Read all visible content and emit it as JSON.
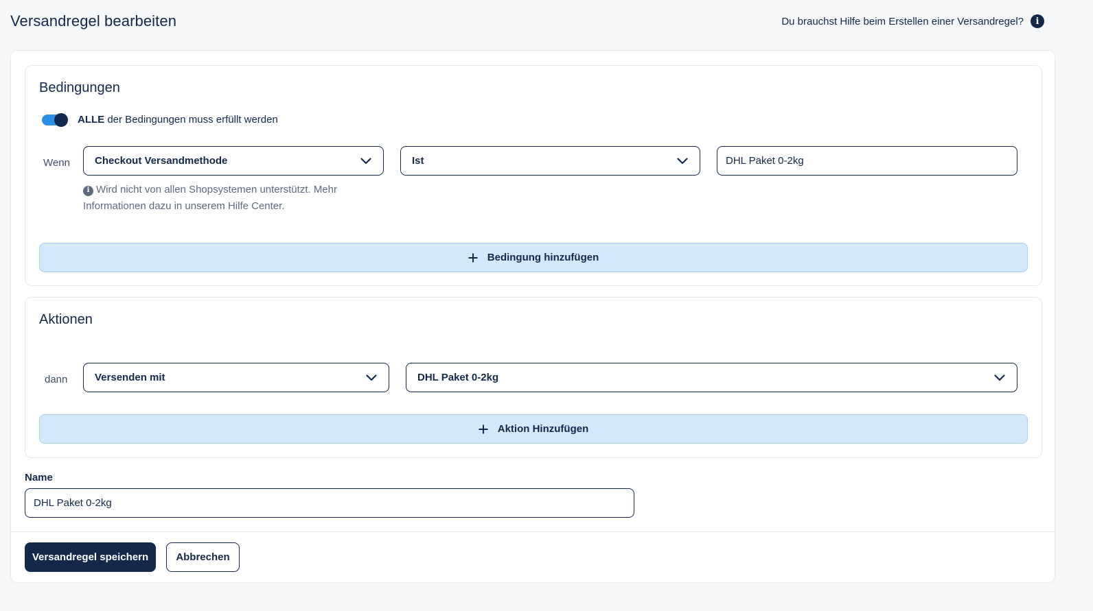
{
  "header": {
    "title": "Versandregel bearbeiten",
    "help_text": "Du brauchst Hilfe beim Erstellen einer Versandregel?",
    "help_icon_glyph": "i"
  },
  "conditions": {
    "title": "Bedingungen",
    "toggle_on": true,
    "toggle_bold": "ALLE",
    "toggle_rest": " der Bedingungen muss erfüllt werden",
    "row_label": "Wenn",
    "field_select": "Checkout Versandmethode",
    "operator_select": "Ist",
    "value": "DHL Paket 0-2kg",
    "hint_icon_glyph": "i",
    "hint_text": "Wird nicht von allen Shopsystemen unterstützt. Mehr Informationen dazu in unserem Hilfe Center.",
    "add_label": "Bedingung hinzufügen",
    "add_icon": "plus-icon"
  },
  "actions": {
    "title": "Aktionen",
    "row_label": "dann",
    "action_select": "Versenden mit",
    "target_select": "DHL Paket 0-2kg",
    "add_label": "Aktion Hinzufügen",
    "add_icon": "plus-icon"
  },
  "name_field": {
    "label": "Name",
    "value": "DHL Paket 0-2kg"
  },
  "footer": {
    "save_label": "Versandregel speichern",
    "cancel_label": "Abbrechen"
  },
  "colors": {
    "primary": "#13284a",
    "toggle": "#2d8ee8",
    "add_button_bg": "#d2e9fc",
    "background": "#f6f7f9"
  }
}
